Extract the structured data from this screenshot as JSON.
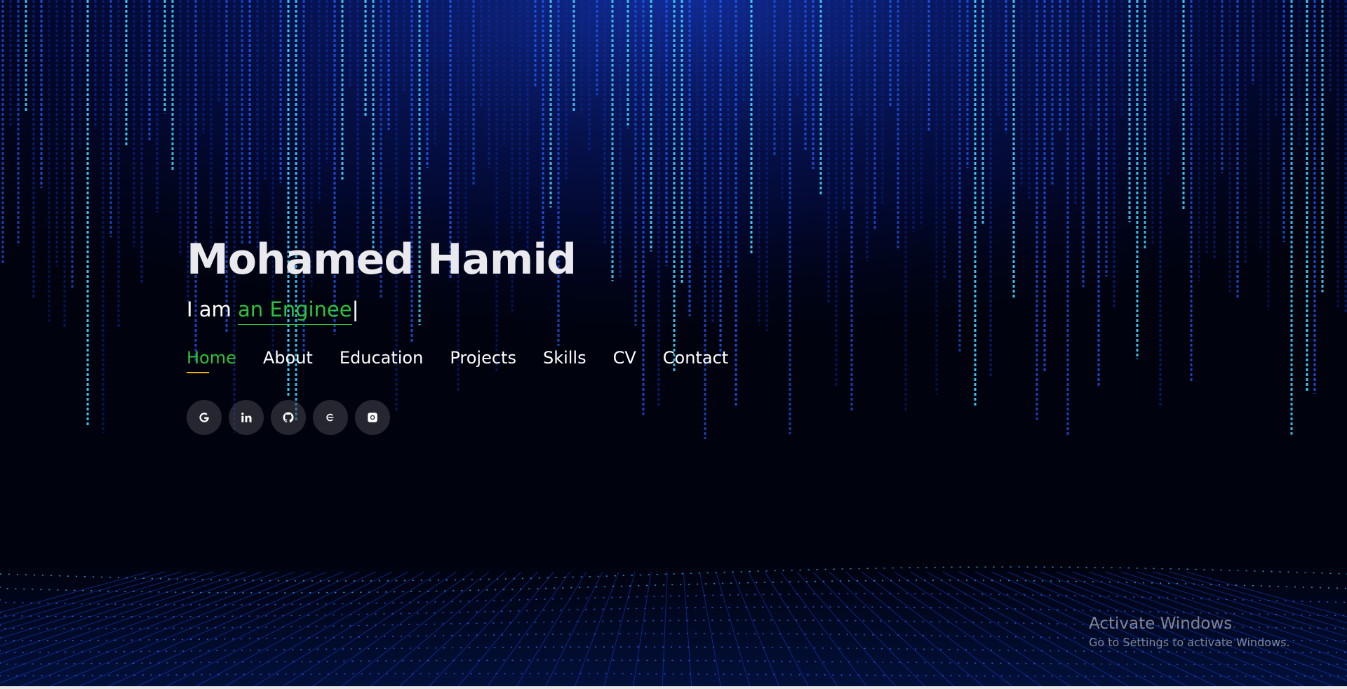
{
  "profile": {
    "name": "Mohamed Hamid",
    "tagline_prefix": "I am ",
    "tagline_typed": "an Enginee",
    "cursor": "|"
  },
  "nav": [
    {
      "label": "Home",
      "active": true
    },
    {
      "label": "About"
    },
    {
      "label": "Education"
    },
    {
      "label": "Projects"
    },
    {
      "label": "Skills"
    },
    {
      "label": "CV"
    },
    {
      "label": "Contact"
    }
  ],
  "social": [
    {
      "icon": "google-icon"
    },
    {
      "icon": "linkedin-icon"
    },
    {
      "icon": "github-icon"
    },
    {
      "icon": "coursera-icon"
    },
    {
      "icon": "camera-icon"
    }
  ],
  "watermark": {
    "title": "Activate Windows",
    "subtitle": "Go to Settings to activate Windows."
  },
  "colors": {
    "accent": "#2ec13a",
    "underline": "#f2b300",
    "background": "#00020d",
    "rain": "#1a4dff"
  }
}
